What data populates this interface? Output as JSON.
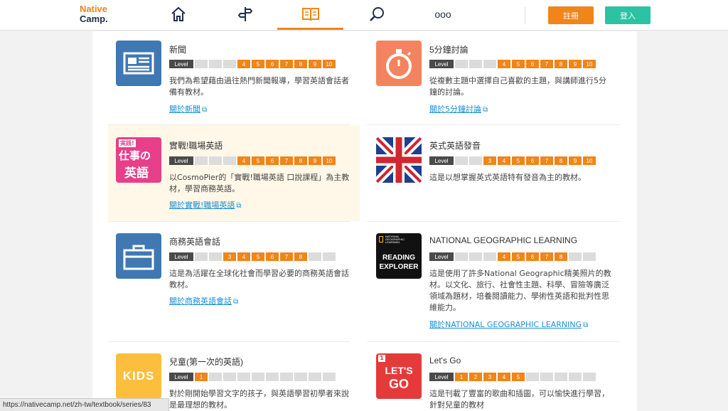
{
  "brand": {
    "line1": "Native",
    "line2": "Camp."
  },
  "nav": {
    "icons": [
      "home-icon",
      "signpost-icon",
      "book-icon",
      "search-icon",
      "more-icon"
    ],
    "more_label": "ooo"
  },
  "auth": {
    "register_label": "註冊",
    "login_label": "登入"
  },
  "level_label": "Level",
  "cards": [
    {
      "title": "新聞",
      "levels": [
        "",
        "",
        "",
        "4",
        "5",
        "6",
        "7",
        "8",
        "9",
        "10"
      ],
      "desc": "我們為希望藉由過往熱門新聞報導，學習英語會話者備有教材。",
      "link": "關於新聞"
    },
    {
      "title": "5分鐘討論",
      "levels": [
        "",
        "",
        "",
        "4",
        "5",
        "6",
        "7",
        "8",
        "9",
        "10"
      ],
      "desc": "從複數主題中選擇自己喜歡的主題，與講師進行5分鐘的討論。",
      "link": "關於5分鐘討論"
    },
    {
      "title": "實戰!職場英語",
      "levels": [
        "",
        "",
        "",
        "4",
        "5",
        "6",
        "7",
        "8",
        "9",
        "10"
      ],
      "desc": "以CosmoPier的「實戰!職場英語 口說課程」為主教材，學習商務英語。",
      "link": "關於實戰!職場英語",
      "thumb_text": {
        "tag": "実践!",
        "line1": "仕事の",
        "line2": "英語"
      }
    },
    {
      "title": "英式英語發音",
      "levels": [
        "",
        "",
        "3",
        "4",
        "5",
        "6",
        "7",
        "8",
        "9",
        "10"
      ],
      "desc": "這是以想掌握英式英語特有發音為主的教材。",
      "link": ""
    },
    {
      "title": "商務英語會話",
      "levels": [
        "",
        "",
        "3",
        "4",
        "5",
        "6",
        "7",
        "8",
        "",
        ""
      ],
      "desc": "這是為活躍在全球化社會而學習必要的商務英語會話教材。",
      "link": "關於商務英語會話"
    },
    {
      "title": "NATIONAL GEOGRAPHIC LEARNING",
      "levels": [
        "",
        "",
        "",
        "4",
        "5",
        "6",
        "7",
        "8",
        "",
        ""
      ],
      "desc": "這是使用了許多National Geographic精美照片的教材。以文化、旅行、社會性主題、科學、冒險等廣泛領域為題材，培養閱讀能力、學術性英語和批判性思維能力。",
      "link": "關於NATIONAL GEOGRAPHIC LEARNING",
      "thumb_text": {
        "brand1": "NATIONAL",
        "brand2": "GEOGRAPHIC",
        "brand3": "LEARNING",
        "line1": "READING",
        "line2": "EXPLORER"
      }
    },
    {
      "title": "兒童(第一次的英語)",
      "levels": [
        "1",
        "",
        "",
        "",
        "",
        "",
        "",
        "",
        "",
        ""
      ],
      "desc": "對於剛開始學習文字的孩子，與英語學習初學者來說是最理想的教材。",
      "link": "",
      "thumb_text": {
        "label": "KIDS"
      }
    },
    {
      "title": "Let's Go",
      "levels": [
        "1",
        "2",
        "3",
        "4",
        "5",
        "",
        "",
        "",
        "",
        ""
      ],
      "desc": "這是刊載了豐富的歌曲和插圖，可以愉快進行學習，針對兒童的教材",
      "link": "",
      "thumb_text": {
        "badge": "1",
        "line1": "LET'S",
        "line2": "GO"
      }
    }
  ],
  "status_url": "https://nativecamp.net/zh-tw/textbook/series/83",
  "colors": {
    "accent": "#f08519",
    "teal": "#2bc3a3",
    "link": "#1a8fd6",
    "level_off": "#dcdcdc",
    "highlight": "#fff8e8"
  }
}
